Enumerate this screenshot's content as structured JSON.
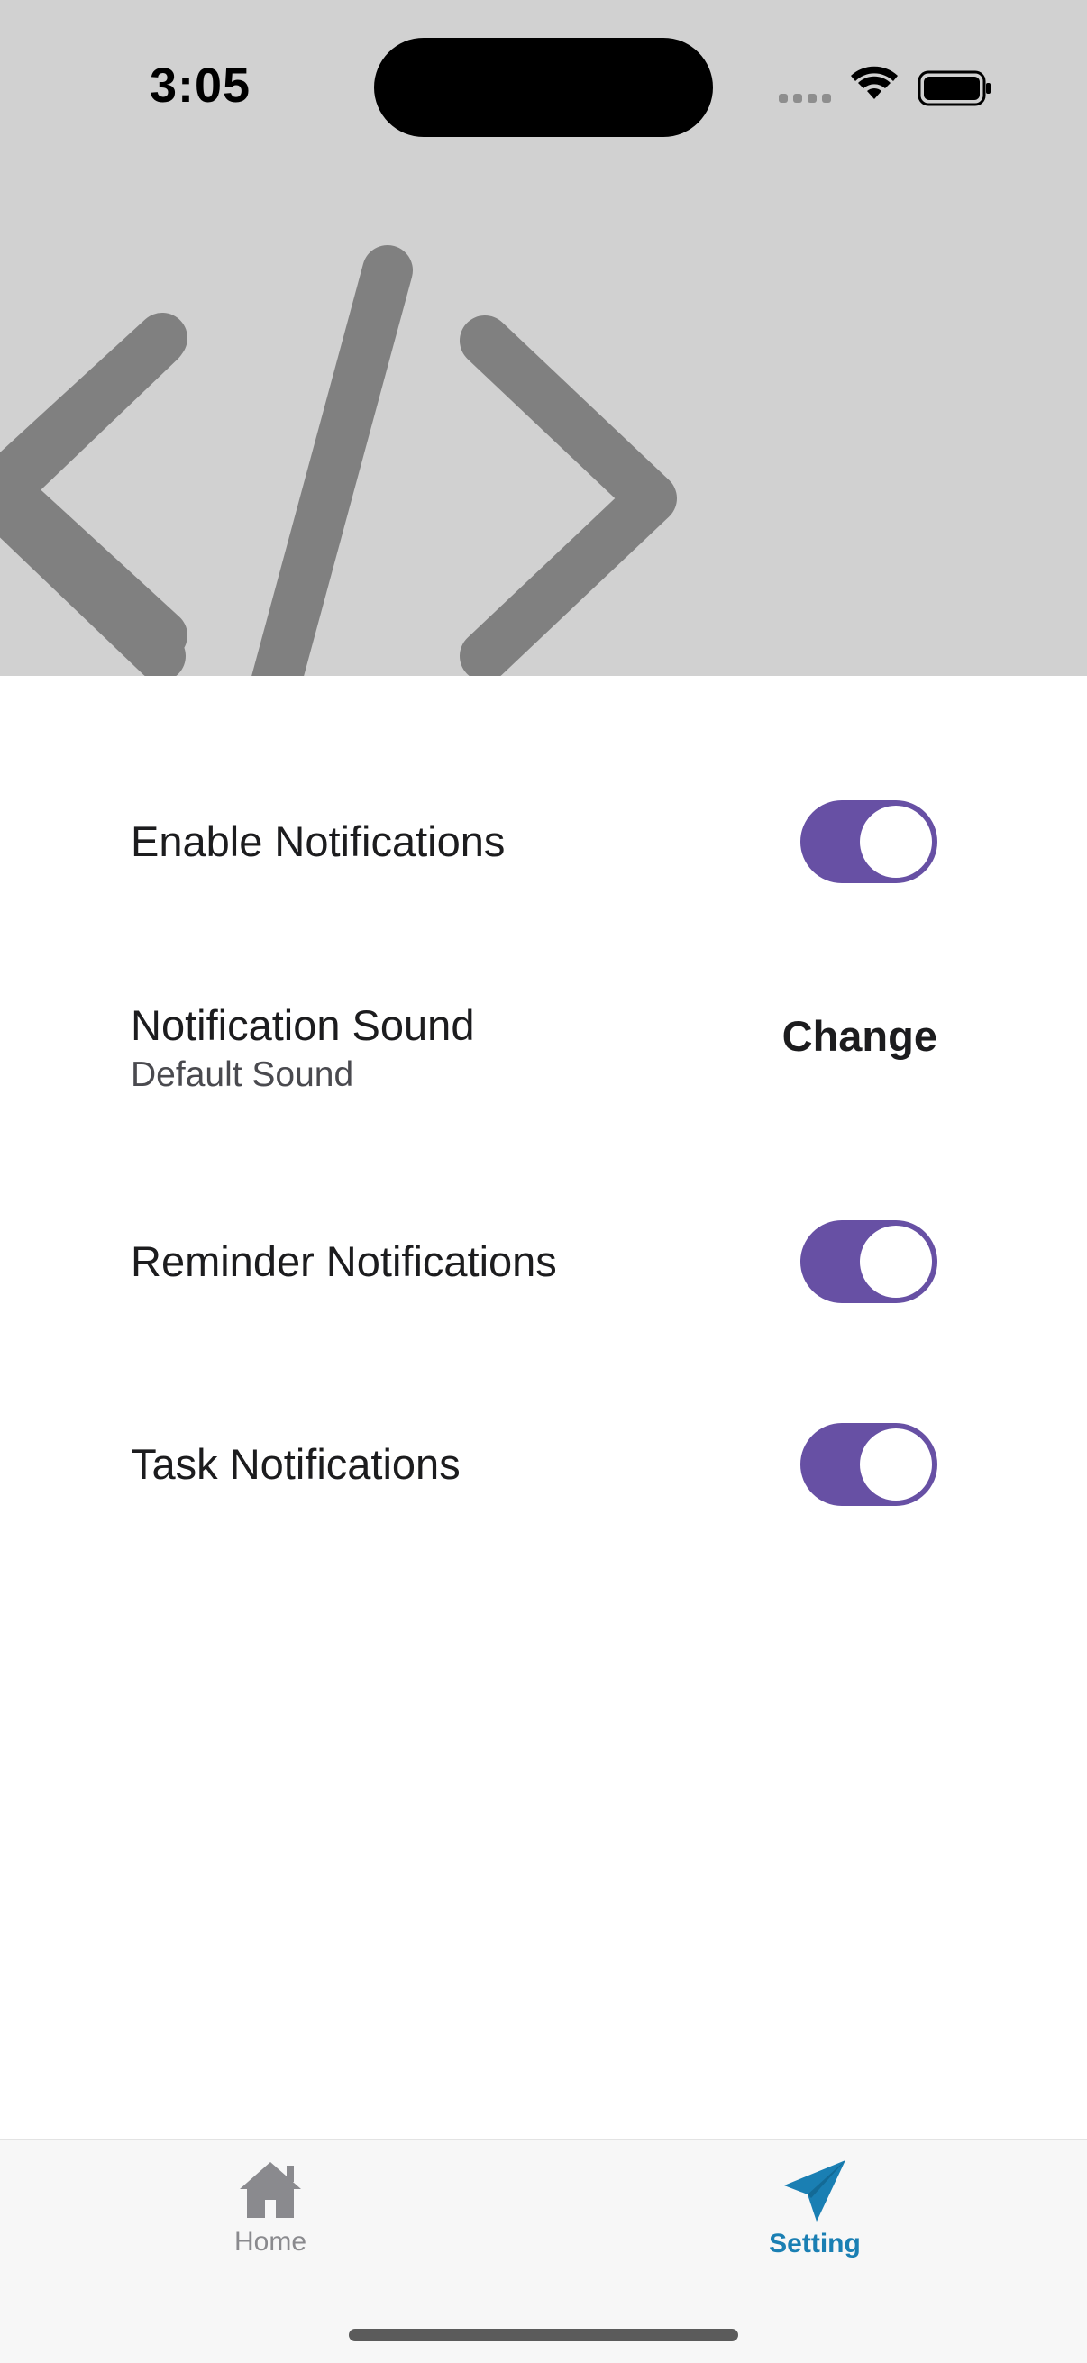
{
  "status_bar": {
    "time": "3:05"
  },
  "header": {
    "image_icon": "code-brackets-icon",
    "art_color": "#808080",
    "background_color": "#d1d1d1"
  },
  "settings": {
    "accent_color": "#6750a4",
    "enable_notifications": {
      "label": "Enable Notifications",
      "enabled": true
    },
    "notification_sound": {
      "label": "Notification Sound",
      "value": "Default Sound",
      "action_label": "Change"
    },
    "reminder_notifications": {
      "label": "Reminder Notifications",
      "enabled": true
    },
    "task_notifications": {
      "label": "Task Notifications",
      "enabled": true
    }
  },
  "tabbar": {
    "tabs": [
      {
        "label": "Home",
        "icon": "house-icon",
        "active": false
      },
      {
        "label": "Setting",
        "icon": "paper-plane-icon",
        "active": true
      }
    ],
    "active_color": "#1a7fb3",
    "inactive_color": "#8a8a8e"
  }
}
